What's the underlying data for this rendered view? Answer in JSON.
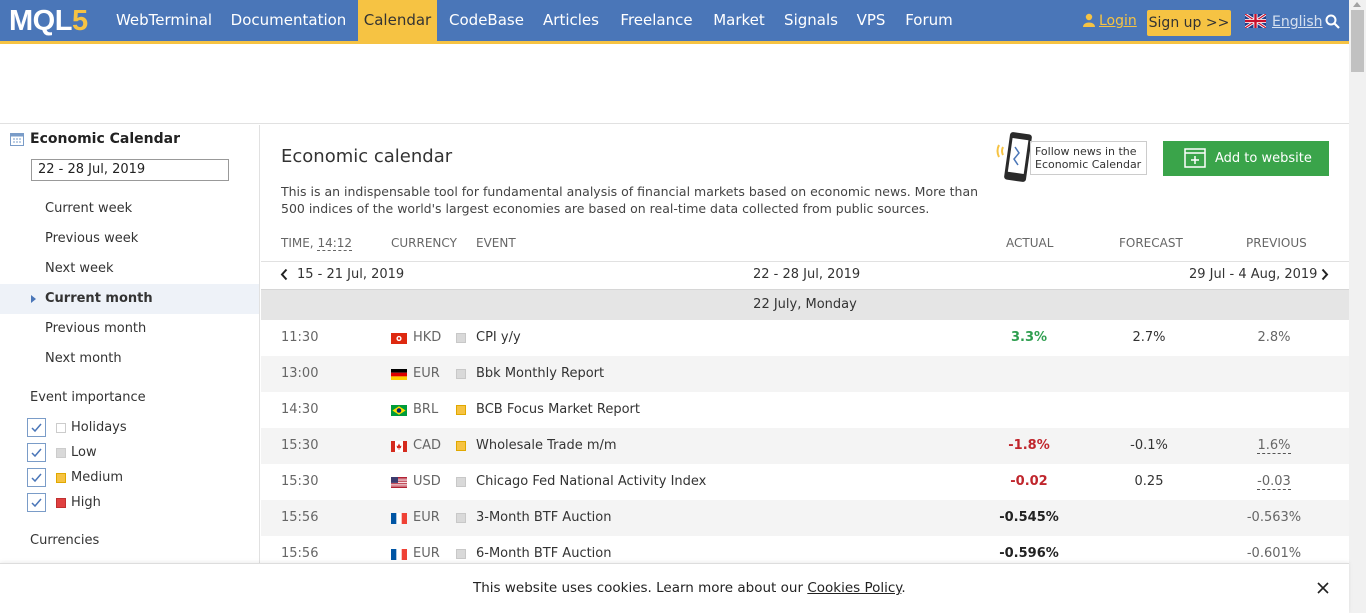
{
  "header": {
    "logo_main": "MQL",
    "logo_five": "5",
    "nav": [
      "WebTerminal",
      "Documentation",
      "Calendar",
      "CodeBase",
      "Articles",
      "Freelance",
      "Market",
      "Signals",
      "VPS",
      "Forum"
    ],
    "active_nav": "Calendar",
    "login": "Login",
    "signup": "Sign up >>",
    "language": "English"
  },
  "sidebar": {
    "title": "Economic Calendar",
    "date_range": "22  - 28 Jul, 2019",
    "periods": [
      "Current week",
      "Previous week",
      "Next week",
      "Current month",
      "Previous month",
      "Next month"
    ],
    "selected_period": "Current month",
    "importance_label": "Event importance",
    "importance": [
      {
        "label": "Holidays",
        "color": "#ffffff",
        "checked": true
      },
      {
        "label": "Low",
        "color": "#d9d9d9",
        "checked": true
      },
      {
        "label": "Medium",
        "color": "#f6c343",
        "checked": true
      },
      {
        "label": "High",
        "color": "#e04040",
        "checked": true
      }
    ],
    "currencies_label": "Currencies"
  },
  "main": {
    "title": "Economic calendar",
    "description": "This is an indispensable tool for fundamental analysis of financial markets based on economic news. More than 500 indices of the world's largest economies are based on real-time data collected from public sources.",
    "follow_line1": "Follow news in the",
    "follow_line2": "Economic Calendar",
    "add_to_website": "Add to website",
    "columns": {
      "time": "TIME,",
      "time_value": "14:12",
      "currency": "CURRENCY",
      "event": "EVENT",
      "actual": "ACTUAL",
      "forecast": "FORECAST",
      "previous": "PREVIOUS"
    },
    "week_prev": "15 - 21 Jul, 2019",
    "week_current": "22 - 28 Jul, 2019",
    "week_next": "29 Jul - 4 Aug, 2019",
    "day_header": "22 July, Monday",
    "events": [
      {
        "time": "11:30",
        "flag": "hk",
        "currency": "HKD",
        "importance": "low",
        "event": "CPI y/y",
        "actual": "3.3%",
        "actual_color": "#2e9e4f",
        "actual_bold": false,
        "forecast": "2.7%",
        "previous": "2.8%",
        "previous_revised": false
      },
      {
        "time": "13:00",
        "flag": "de",
        "currency": "EUR",
        "importance": "low",
        "event": "Bbk Monthly Report",
        "actual": "",
        "actual_color": "#333333",
        "actual_bold": false,
        "forecast": "",
        "previous": "",
        "previous_revised": false
      },
      {
        "time": "14:30",
        "flag": "br",
        "currency": "BRL",
        "importance": "medium",
        "event": "BCB Focus Market Report",
        "actual": "",
        "actual_color": "#333333",
        "actual_bold": false,
        "forecast": "",
        "previous": "",
        "previous_revised": false
      },
      {
        "time": "15:30",
        "flag": "ca",
        "currency": "CAD",
        "importance": "medium",
        "event": "Wholesale Trade m/m",
        "actual": "-1.8%",
        "actual_color": "#c0262d",
        "actual_bold": false,
        "forecast": "-0.1%",
        "previous": "1.6%",
        "previous_revised": true
      },
      {
        "time": "15:30",
        "flag": "us",
        "currency": "USD",
        "importance": "low",
        "event": "Chicago Fed National Activity Index",
        "actual": "-0.02",
        "actual_color": "#c0262d",
        "actual_bold": false,
        "forecast": "0.25",
        "previous": "-0.03",
        "previous_revised": true
      },
      {
        "time": "15:56",
        "flag": "fr",
        "currency": "EUR",
        "importance": "low",
        "event": "3-Month BTF Auction",
        "actual": "-0.545%",
        "actual_color": "#222222",
        "actual_bold": true,
        "forecast": "",
        "previous": "-0.563%",
        "previous_revised": false
      },
      {
        "time": "15:56",
        "flag": "fr",
        "currency": "EUR",
        "importance": "low",
        "event": "6-Month BTF Auction",
        "actual": "-0.596%",
        "actual_color": "#222222",
        "actual_bold": true,
        "forecast": "",
        "previous": "-0.601%",
        "previous_revised": false
      }
    ]
  },
  "cookie": {
    "text": "This website uses cookies. Learn more about our ",
    "link": "Cookies Policy",
    "suffix": "."
  },
  "colors": {
    "header_bg": "#4a76b8",
    "accent": "#f6c343",
    "add_button": "#3aa44a"
  }
}
